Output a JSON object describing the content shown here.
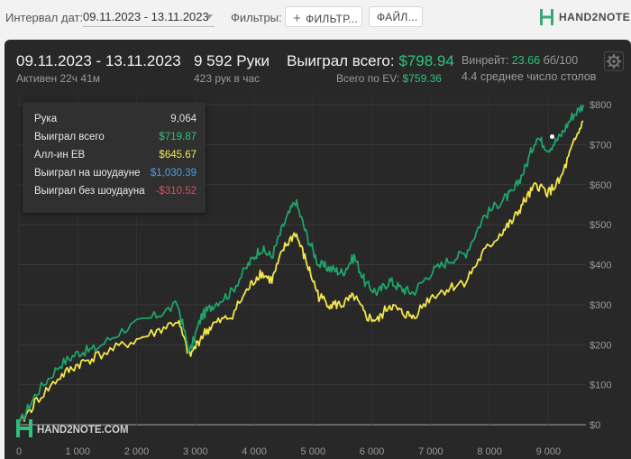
{
  "topbar": {
    "date_interval_label": "Интервал дат:",
    "date_interval_value": "09.11.2023 - 13.11.2023",
    "filters_label": "Фильтры:",
    "filter_button": "ФИЛЬТР...",
    "file_button": "ФАЙЛ...",
    "logo_text": "HAND2NOTE.COM"
  },
  "summary": {
    "period": "09.11.2023 - 13.11.2023",
    "active": "Активен 22ч 41м",
    "hands": "9 592 Руки",
    "hands_per_hour": "423 рук в час",
    "won_label": "Выиграл всего:",
    "won_value": "$798.94",
    "ev_label": "Всего по EV:",
    "ev_value": "$759.36",
    "winrate_label": "Винрейт:",
    "winrate_value": "23.66",
    "winrate_unit": "бб/100",
    "avg_tables": "4.4 среднее число столов"
  },
  "tooltip": {
    "rows": [
      {
        "label": "Рука",
        "value": "9,064",
        "color": "#dddddd"
      },
      {
        "label": "Выиграл всего",
        "value": "$719.87",
        "color": "#2ec27e"
      },
      {
        "label": "Алл-ин ЕВ",
        "value": "$645.67",
        "color": "#f2e64a"
      },
      {
        "label": "Выиграл на шоудауне",
        "value": "$1,030.39",
        "color": "#4a9ee8"
      },
      {
        "label": "Выиграл без шоудауна",
        "value": "-$310.52",
        "color": "#e04a5a"
      }
    ]
  },
  "watermark": "HAND2NOTE.COM",
  "colors": {
    "won": "#1fa36b",
    "allin_ev": "#f2e64a",
    "showdown": "#4a9ee8",
    "non_showdown": "#e04a5a"
  },
  "chart_data": {
    "type": "line",
    "x_ticks": [
      "0",
      "1 000",
      "2 000",
      "3 000",
      "4 000",
      "5 000",
      "6 000",
      "7 000",
      "8 000",
      "9 000"
    ],
    "y_ticks": [
      "$0",
      "$100",
      "$200",
      "$300",
      "$400",
      "$500",
      "$600",
      "$700",
      "$800"
    ],
    "xlim": [
      0,
      9592
    ],
    "ylim": [
      0,
      800
    ],
    "grid": true,
    "x": [
      0,
      300,
      700,
      1000,
      1300,
      1800,
      2300,
      2700,
      2900,
      3100,
      3300,
      3600,
      3900,
      4100,
      4300,
      4500,
      4700,
      4900,
      5100,
      5300,
      5500,
      5700,
      5900,
      6100,
      6300,
      6500,
      6700,
      7000,
      7300,
      7600,
      7900,
      8200,
      8400,
      8600,
      8800,
      9000,
      9200,
      9400,
      9592
    ],
    "series": [
      {
        "name": "Выиграл всего",
        "values": [
          0,
          80,
          150,
          180,
          190,
          240,
          270,
          300,
          180,
          270,
          300,
          330,
          400,
          440,
          420,
          500,
          560,
          470,
          400,
          390,
          380,
          420,
          350,
          330,
          360,
          340,
          330,
          380,
          410,
          430,
          520,
          560,
          580,
          640,
          720,
          690,
          720,
          770,
          798.94
        ]
      },
      {
        "name": "Алл-ин ЕВ",
        "values": [
          0,
          60,
          120,
          150,
          170,
          200,
          230,
          260,
          170,
          220,
          250,
          270,
          340,
          380,
          360,
          440,
          480,
          400,
          320,
          300,
          300,
          320,
          270,
          260,
          300,
          280,
          270,
          320,
          340,
          360,
          430,
          480,
          510,
          560,
          600,
          580,
          610,
          690,
          759.36
        ]
      }
    ]
  }
}
